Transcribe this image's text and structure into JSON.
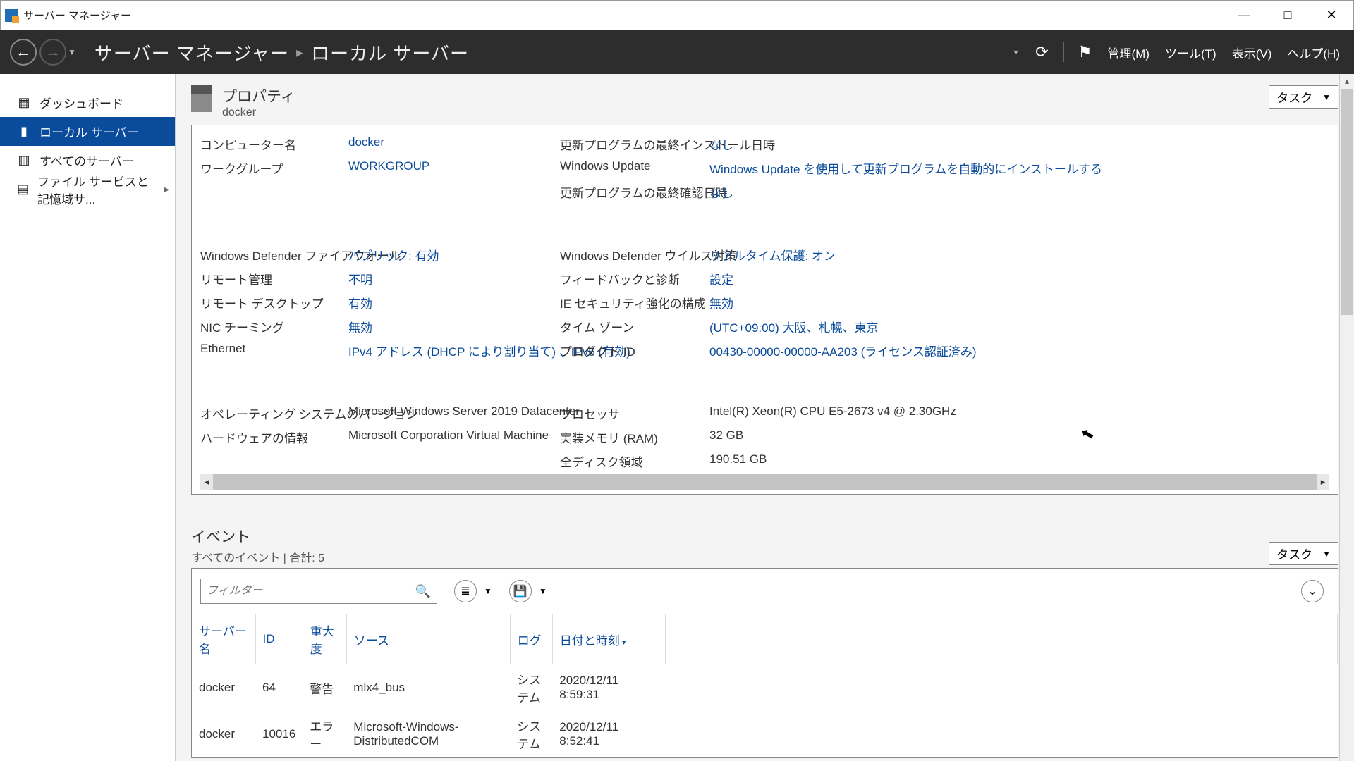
{
  "window": {
    "title": "サーバー マネージャー"
  },
  "header": {
    "breadcrumb": [
      "サーバー マネージャー",
      "ローカル サーバー"
    ],
    "menus": {
      "manage": "管理(M)",
      "tools": "ツール(T)",
      "view": "表示(V)",
      "help": "ヘルプ(H)"
    }
  },
  "sidebar": {
    "items": [
      {
        "label": "ダッシュボード",
        "icon": "dashboard"
      },
      {
        "label": "ローカル サーバー",
        "icon": "server",
        "active": true
      },
      {
        "label": "すべてのサーバー",
        "icon": "servers"
      },
      {
        "label": "ファイル サービスと記憶域サ...",
        "icon": "file",
        "chevron": true
      }
    ]
  },
  "properties": {
    "section_title": "プロパティ",
    "subtitle": "docker",
    "tasks_label": "タスク",
    "rows": {
      "computer_name": {
        "label": "コンピューター名",
        "value": "docker"
      },
      "workgroup": {
        "label": "ワークグループ",
        "value": "WORKGROUP"
      },
      "last_update": {
        "label": "更新プログラムの最終インストール日時",
        "value": "なし"
      },
      "windows_update": {
        "label": "Windows Update",
        "value": "Windows Update を使用して更新プログラムを自動的にインストールする"
      },
      "last_checked": {
        "label": "更新プログラムの最終確認日時",
        "value": "なし"
      },
      "firewall": {
        "label": "Windows Defender ファイアウォール",
        "value": "パブリック: 有効"
      },
      "remote_mgmt": {
        "label": "リモート管理",
        "value": "不明"
      },
      "remote_desktop": {
        "label": "リモート デスクトップ",
        "value": "有効"
      },
      "nic_teaming": {
        "label": "NIC チーミング",
        "value": "無効"
      },
      "ethernet": {
        "label": "Ethernet",
        "value": "IPv4 アドレス (DHCP により割り当て) 、IPv6 (有効)"
      },
      "defender_av": {
        "label": "Windows Defender ウイルス対策",
        "value": "リアルタイム保護: オン"
      },
      "feedback": {
        "label": "フィードバックと診断",
        "value": "設定"
      },
      "ie_esc": {
        "label": "IE セキュリティ強化の構成",
        "value": "無効"
      },
      "timezone": {
        "label": "タイム ゾーン",
        "value": "(UTC+09:00) 大阪、札幌、東京"
      },
      "product_id": {
        "label": "プロダクト ID",
        "value": "00430-00000-00000-AA203 (ライセンス認証済み)"
      },
      "os_version": {
        "label": "オペレーティング システムのバージョン",
        "value": "Microsoft Windows Server 2019 Datacenter"
      },
      "hardware": {
        "label": "ハードウェアの情報",
        "value": "Microsoft Corporation Virtual Machine"
      },
      "processor": {
        "label": "プロセッサ",
        "value": "Intel(R) Xeon(R) CPU E5-2673 v4 @ 2.30GHz"
      },
      "ram": {
        "label": "実装メモリ (RAM)",
        "value": "32 GB"
      },
      "disk": {
        "label": "全ディスク領域",
        "value": "190.51 GB"
      }
    }
  },
  "events": {
    "section_title": "イベント",
    "summary": "すべてのイベント | 合計: 5",
    "tasks_label": "タスク",
    "filter_placeholder": "フィルター",
    "columns": {
      "server": "サーバー名",
      "id": "ID",
      "severity": "重大度",
      "source": "ソース",
      "log": "ログ",
      "datetime": "日付と時刻"
    },
    "rows": [
      {
        "server": "docker",
        "id": "64",
        "severity": "警告",
        "source": "mlx4_bus",
        "log": "システム",
        "datetime": "2020/12/11 8:59:31"
      },
      {
        "server": "docker",
        "id": "10016",
        "severity": "エラー",
        "source": "Microsoft-Windows-DistributedCOM",
        "log": "システム",
        "datetime": "2020/12/11 8:52:41"
      }
    ]
  }
}
